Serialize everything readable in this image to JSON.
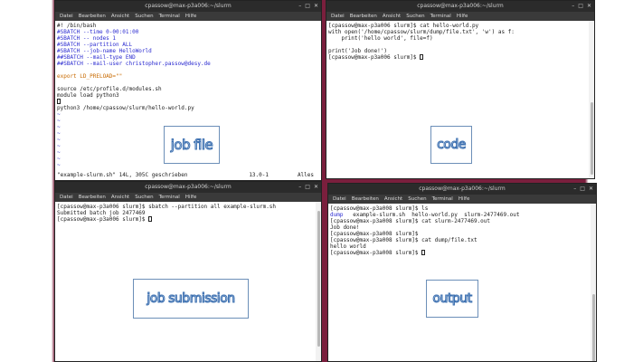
{
  "windows": {
    "jobfile": {
      "title": "cpassow@max-p3a006:~/slurm",
      "menu": [
        "Datei",
        "Bearbeiten",
        "Ansicht",
        "Suchen",
        "Terminal",
        "Hilfe"
      ],
      "lines": [
        {
          "text": "#! /bin/bash",
          "color": "default"
        },
        {
          "text": "#SBATCH --time 0-00:01:00",
          "color": "blue"
        },
        {
          "text": "#SBATCH -- nodes 1",
          "color": "blue"
        },
        {
          "text": "#SBATCH --partition ALL",
          "color": "blue"
        },
        {
          "text": "#SBATCH --job-name HelloWorld",
          "color": "blue"
        },
        {
          "text": "##SBATCH --mail-type END",
          "color": "blue"
        },
        {
          "text": "##SBATCH --mail-user christopher.passow@desy.de",
          "color": "blue"
        },
        {
          "text": "",
          "color": "default"
        },
        {
          "text": "export LD_PRELOAD=\"\"",
          "color": "orange"
        },
        {
          "text": "",
          "color": "default"
        },
        {
          "text": "source /etc/profile.d/modules.sh",
          "color": "default"
        },
        {
          "text": "module load python3",
          "color": "default"
        },
        {
          "text": "",
          "color": "default"
        },
        {
          "text": "python3 /home/cpassow/slurm/hello-world.py",
          "color": "default"
        },
        {
          "text": "~",
          "color": "tilde"
        },
        {
          "text": "~",
          "color": "tilde"
        },
        {
          "text": "~",
          "color": "tilde"
        },
        {
          "text": "~",
          "color": "tilde"
        },
        {
          "text": "~",
          "color": "tilde"
        },
        {
          "text": "~",
          "color": "tilde"
        },
        {
          "text": "~",
          "color": "tilde"
        },
        {
          "text": "~",
          "color": "tilde"
        },
        {
          "text": "~",
          "color": "tilde"
        }
      ],
      "status_file": "\"example-slurm.sh\" 14L, 305C geschrieben",
      "status_pos": "13.0-1",
      "status_all": "Alles",
      "label": "job file"
    },
    "code": {
      "title": "cpassow@max-p3a006:~/slurm",
      "menu": [
        "Datei",
        "Bearbeiten",
        "Ansicht",
        "Suchen",
        "Terminal",
        "Hilfe"
      ],
      "lines": [
        "[cpassow@max-p3a006 slurm]$ cat hello-world.py",
        "with open('/home/cpassow/slurm/dump/file.txt', 'w') as f:",
        "    print('hello world', file=f)",
        "",
        "print('Job done!')",
        "[cpassow@max-p3a006 slurm]$ "
      ],
      "label": "code"
    },
    "submission": {
      "title": "cpassow@max-p3a006:~/slurm",
      "menu": [
        "Datei",
        "Bearbeiten",
        "Ansicht",
        "Suchen",
        "Terminal",
        "Hilfe"
      ],
      "lines": [
        "[cpassow@max-p3a006 slurm]$ sbatch --partition all example-slurm.sh",
        "Submitted batch job 2477469",
        "[cpassow@max-p3a006 slurm]$ "
      ],
      "label": "job submission"
    },
    "output": {
      "title": "cpassow@max-p3a006:~/slurm",
      "menu": [
        "Datei",
        "Bearbeiten",
        "Ansicht",
        "Suchen",
        "Terminal",
        "Hilfe"
      ],
      "lines": [
        "[cpassow@max-p3a008 slurm]$ ls",
        "dump   example-slurm.sh  hello-world.py  slurm-2477469.out",
        "[cpassow@max-p3a008 slurm]$ cat slurm-2477469.out",
        "Job done!",
        "[cpassow@max-p3a008 slurm]$ ",
        "[cpassow@max-p3a008 slurm]$ cat dump/file.txt",
        "hello world",
        "[cpassow@max-p3a008 slurm]$ "
      ],
      "ls_dir": "dump",
      "label": "output"
    }
  },
  "window_buttons": [
    "–",
    "□",
    "✕"
  ],
  "colors": {
    "background": "#7a1f3d",
    "label_outline": "#3b6fb0",
    "comment_blue": "#2a2ad0",
    "orange": "#c86a00"
  }
}
